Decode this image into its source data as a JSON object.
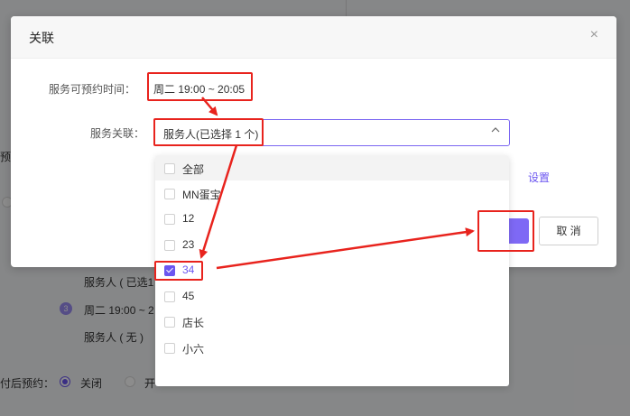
{
  "background": {
    "item_1": "预",
    "service_person_selected": "服务人 ( 已选1",
    "step_3_num": "3",
    "step_3_time": "周二 19:00 ~ 2",
    "service_person_none": "服务人 ( 无 )",
    "after_booking_label": "付后预约：",
    "radio_off_label": "关闭",
    "radio_on_label": "开"
  },
  "modal": {
    "title": "关联",
    "close": "×",
    "time_label": "服务可预约时间：",
    "time_value": "周二 19:00 ~ 20:05",
    "link_label": "服务关联：",
    "select_value": "服务人(已选择 1 个)",
    "setting_link": "设置",
    "cancel": "取 消"
  },
  "dropdown": {
    "options": [
      {
        "label": "全部",
        "checked": false
      },
      {
        "label": "MN蛋宝",
        "checked": false
      },
      {
        "label": "12",
        "checked": false
      },
      {
        "label": "23",
        "checked": false
      },
      {
        "label": "34",
        "checked": true
      },
      {
        "label": "45",
        "checked": false
      },
      {
        "label": "店长",
        "checked": false
      },
      {
        "label": "小六",
        "checked": false
      }
    ]
  },
  "colors": {
    "accent": "#6b55f0",
    "annotation": "#e8231d"
  }
}
